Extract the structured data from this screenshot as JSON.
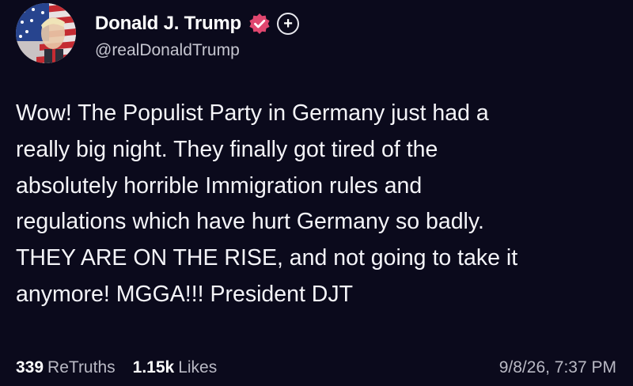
{
  "author": {
    "display_name": "Donald J. Trump",
    "handle": "@realDonaldTrump",
    "verified": true
  },
  "icons": {
    "avatar": "avatar-image",
    "verified": "verified-badge-icon",
    "follow": "follow-plus-icon"
  },
  "follow": {
    "label": "+"
  },
  "post": {
    "text": "Wow! The Populist Party in Germany just had a\nreally big night. They finally got tired of the\nabsolutely horrible Immigration rules and\nregulations which have hurt Germany so badly.\nTHEY ARE ON THE RISE, and not going to take it\nanymore! MGGA!!! President DJT"
  },
  "stats": {
    "retruths_count": "339",
    "retruths_label": "ReTruths",
    "likes_count": "1.15k",
    "likes_label": "Likes"
  },
  "timestamp": "9/8/26, 7:37 PM",
  "colors": {
    "background": "#0b0a1c",
    "text": "#f4f4f8",
    "muted": "#b9b9c4",
    "verified_badge": "#e0476f"
  }
}
